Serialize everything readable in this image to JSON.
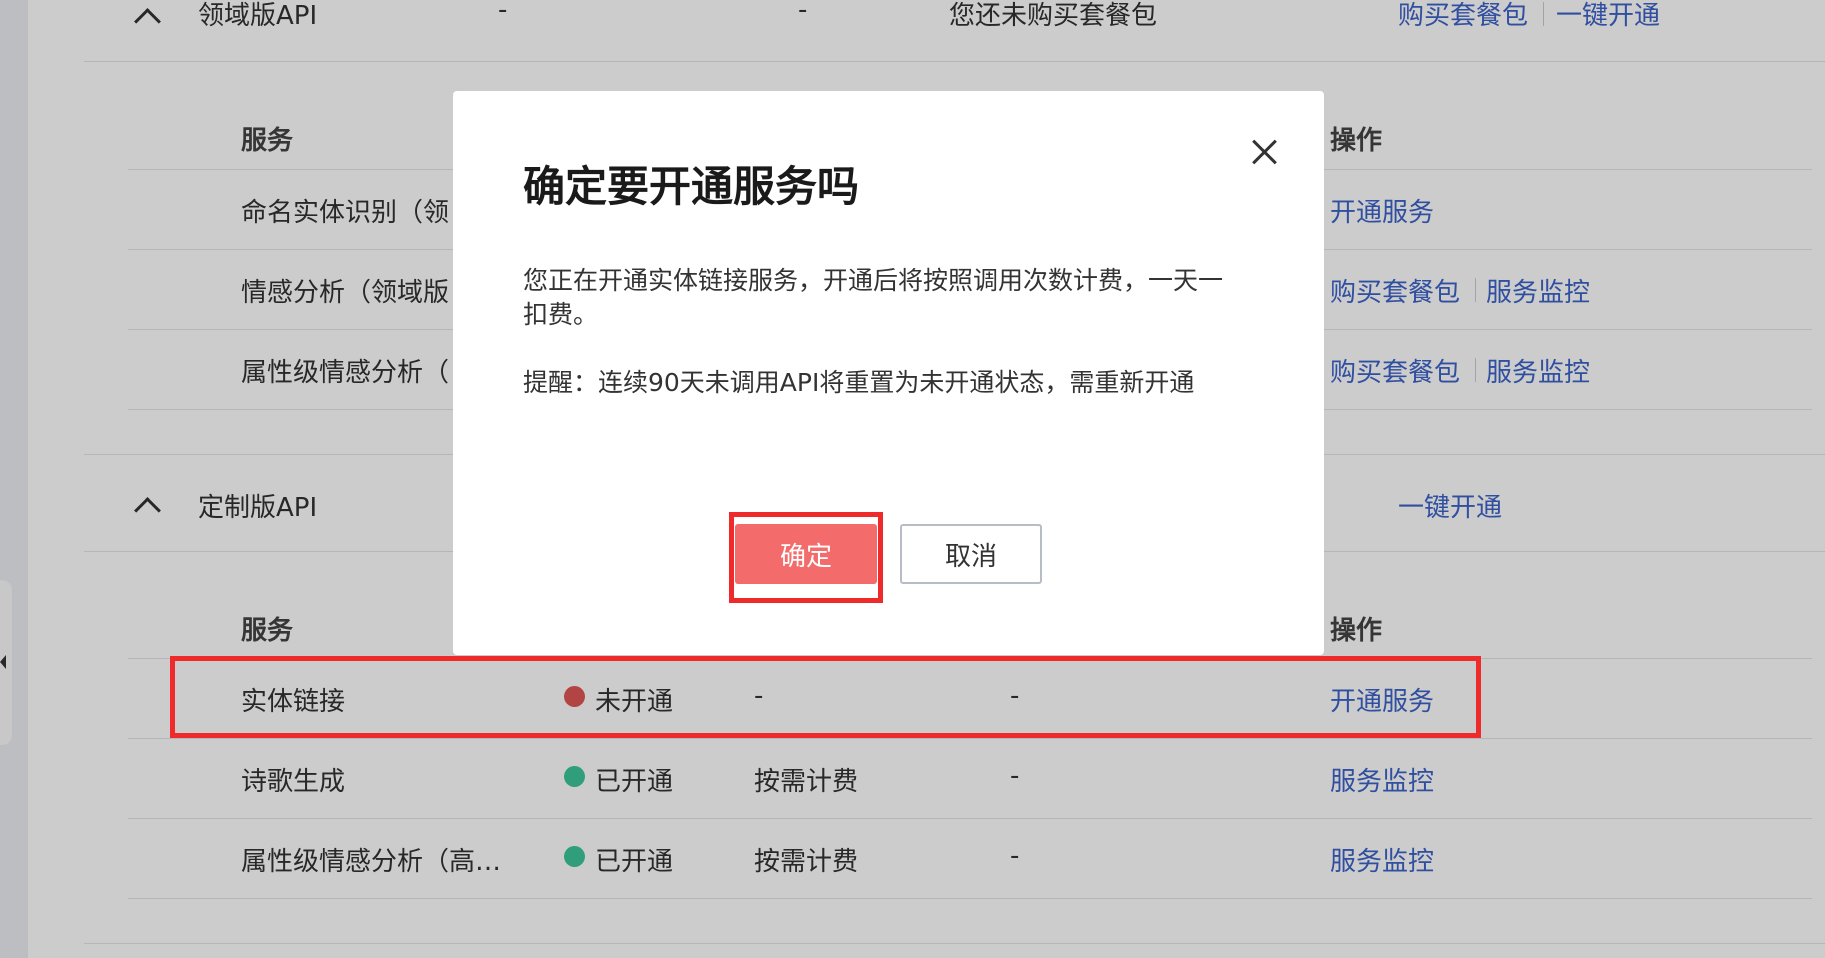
{
  "section_domain": {
    "title": "领域版API",
    "col2": "-",
    "col3": "-",
    "status": "您还未购买套餐包",
    "action_buy": "购买套餐包",
    "action_open_all": "一键开通",
    "header_service": "服务",
    "header_action": "操作",
    "rows": [
      {
        "name": "命名实体识别（领",
        "action1": "开通服务"
      },
      {
        "name": "情感分析（领域版",
        "action1": "购买套餐包",
        "action2": "服务监控"
      },
      {
        "name": "属性级情感分析（",
        "action1": "购买套餐包",
        "action2": "服务监控"
      }
    ]
  },
  "section_custom": {
    "title": "定制版API",
    "action_open_all": "一键开通",
    "header_service": "服务",
    "header_action": "操作",
    "rows": [
      {
        "name": "实体链接",
        "status": "未开通",
        "status_color": "#e05555",
        "billing": "-",
        "col4": "-",
        "action1": "开通服务"
      },
      {
        "name": "诗歌生成",
        "status": "已开通",
        "status_color": "#3cc59a",
        "billing": "按需计费",
        "col4": "-",
        "action1": "服务监控"
      },
      {
        "name": "属性级情感分析（高…",
        "status": "已开通",
        "status_color": "#3cc59a",
        "billing": "按需计费",
        "col4": "-",
        "action1": "服务监控"
      }
    ]
  },
  "modal": {
    "title": "确定要开通服务吗",
    "body_line1": "您正在开通实体链接服务，开通后将按照调用次数计费，一天一扣费。",
    "body_line2": "提醒：连续90天未调用API将重置为未开通状态，需重新开通",
    "confirm_label": "确定",
    "cancel_label": "取消"
  },
  "colors": {
    "link": "#3c63c9",
    "highlight": "#ee2a2a",
    "confirm": "#f36b6b"
  }
}
